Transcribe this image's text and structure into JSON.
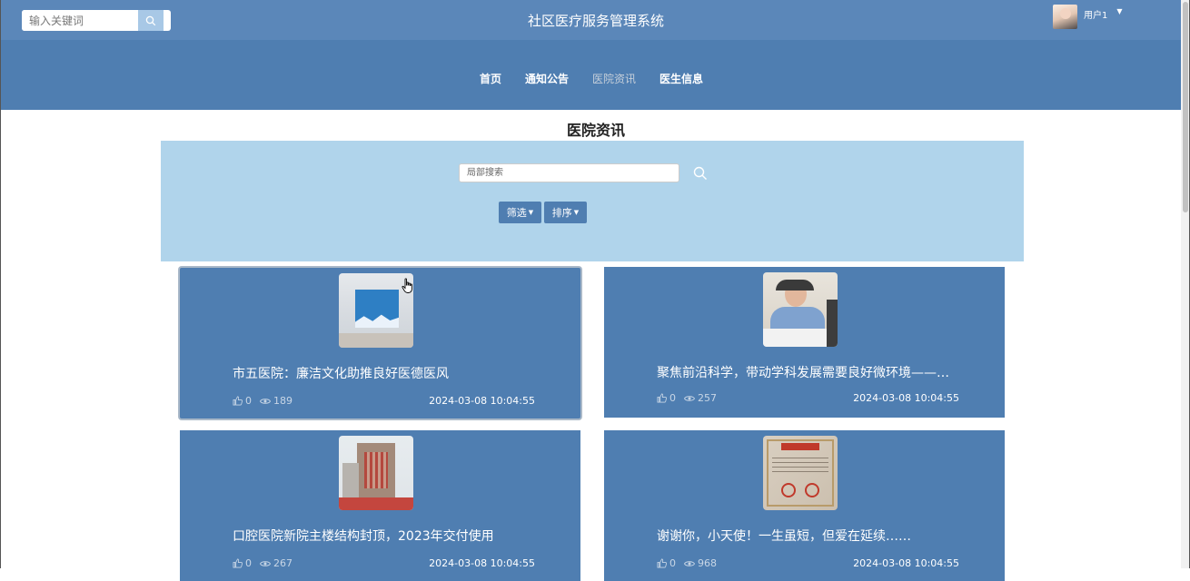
{
  "header": {
    "search_placeholder": "输入关键词",
    "system_title": "社区医疗服务管理系统",
    "user_name": "用户1"
  },
  "nav": {
    "items": [
      {
        "label": "首页",
        "active": false
      },
      {
        "label": "通知公告",
        "active": false
      },
      {
        "label": "医院资讯",
        "active": true
      },
      {
        "label": "医生信息",
        "active": false
      }
    ]
  },
  "page": {
    "title": "医院资讯",
    "local_search_placeholder": "局部搜索",
    "filter_label": "筛选",
    "sort_label": "排序"
  },
  "articles": [
    {
      "title": "市五医院：廉洁文化助推良好医德医风",
      "likes": "0",
      "views": "189",
      "date": "2024-03-08 10:04:55"
    },
    {
      "title": "聚焦前沿科学，带动学科发展需要良好微环境——…",
      "likes": "0",
      "views": "257",
      "date": "2024-03-08 10:04:55"
    },
    {
      "title": "口腔医院新院主楼结构封顶，2023年交付使用",
      "likes": "0",
      "views": "267",
      "date": "2024-03-08 10:04:55"
    },
    {
      "title": "谢谢你，小天使！一生虽短，但爱在延续……",
      "likes": "0",
      "views": "968",
      "date": "2024-03-08 10:04:55"
    }
  ],
  "colors": {
    "topbar": "#5b87b9",
    "nav": "#4f7eb1",
    "panel": "#b0d4eb",
    "card": "#4f7eb1"
  }
}
